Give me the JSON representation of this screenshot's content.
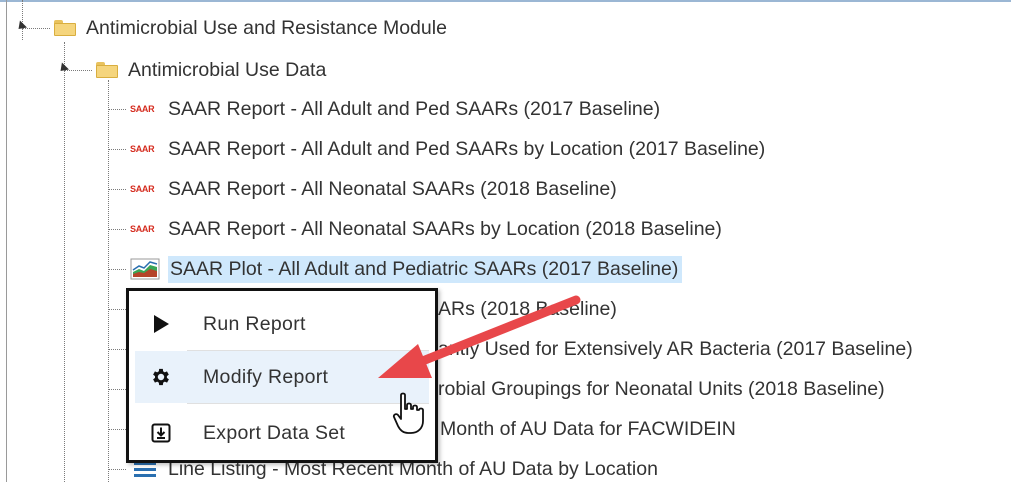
{
  "tree": {
    "root_label": "Antimicrobial Use and Resistance Module",
    "folder_label": "Antimicrobial Use Data",
    "items": [
      {
        "icon": "SAAR",
        "label": "SAAR Report - All Adult and Ped SAARs (2017 Baseline)"
      },
      {
        "icon": "SAAR",
        "label": "SAAR Report - All Adult and Ped SAARs by Location (2017 Baseline)"
      },
      {
        "icon": "SAAR",
        "label": "SAAR Report - All Neonatal SAARs (2018 Baseline)"
      },
      {
        "icon": "SAAR",
        "label": "SAAR Report - All Neonatal SAARs by Location (2018 Baseline)"
      },
      {
        "icon": "plot-icon",
        "label": "SAAR Plot - All Adult and Pediatric SAARs (2017 Baseline)"
      },
      {
        "label": "ARs (2018 Baseline)"
      },
      {
        "label": "antly Used for Extensively AR Bacteria (2017 Baseline)"
      },
      {
        "label": "robial Groupings for Neonatal Units (2018 Baseline)"
      },
      {
        "label": "Month of AU Data for FACWIDEIN"
      },
      {
        "icon": "list-icon",
        "label": "Line Listing - Most Recent Month of AU Data by Location"
      }
    ]
  },
  "context_menu": {
    "items": [
      {
        "icon": "play-icon",
        "label": "Run Report"
      },
      {
        "icon": "gear-icon",
        "label": "Modify Report"
      },
      {
        "icon": "download-icon",
        "label": "Export Data Set"
      }
    ]
  },
  "colors": {
    "selected_bg": "#cfe8fc",
    "annotation_arrow": "#e8474a",
    "saar_icon": "#d52b1e"
  }
}
